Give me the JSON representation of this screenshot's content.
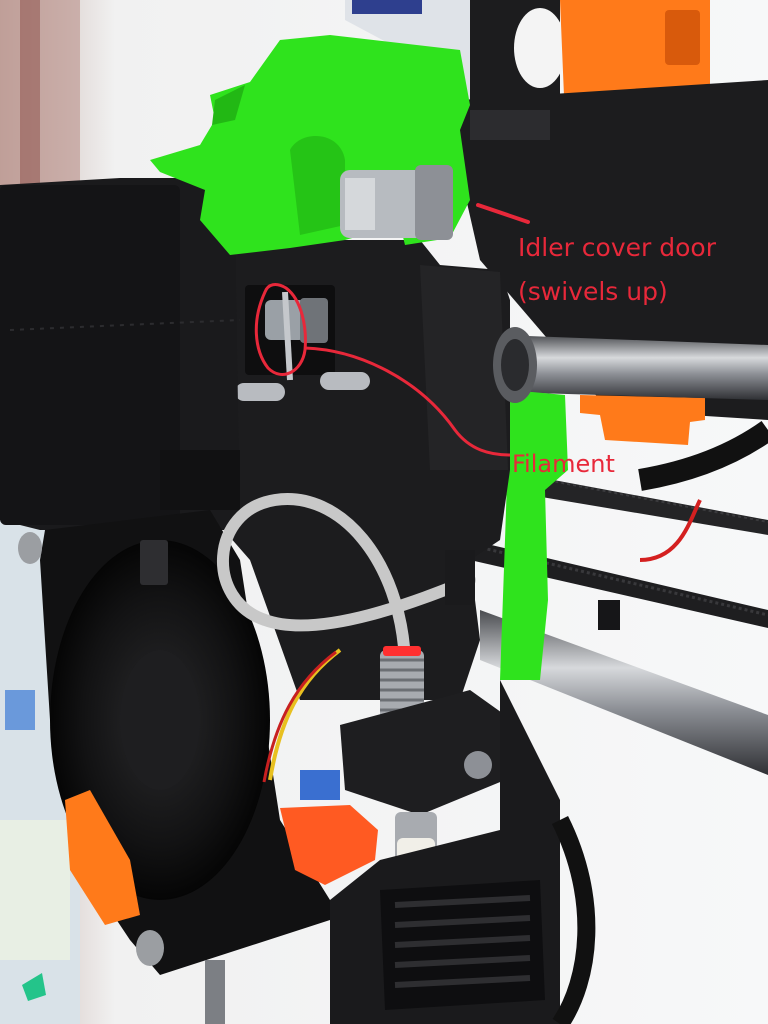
{
  "photo": {
    "subject": "3d-printer-extruder-closeup",
    "colors": {
      "background": "#e9edf0",
      "window_light": "#f6f7f8",
      "black_print": "#1c1c1e",
      "black_print_light": "#2c2c2f",
      "green_print": "#2fe31d",
      "orange_print": "#ff7a1a",
      "rod": "#8d9096",
      "annotation": "#e8283a",
      "ptfe_tube": "#c8c8c8"
    }
  },
  "annotations": {
    "idler_line1": "Idler cover door",
    "idler_line2": "(swivels up)",
    "filament": "Filament"
  }
}
